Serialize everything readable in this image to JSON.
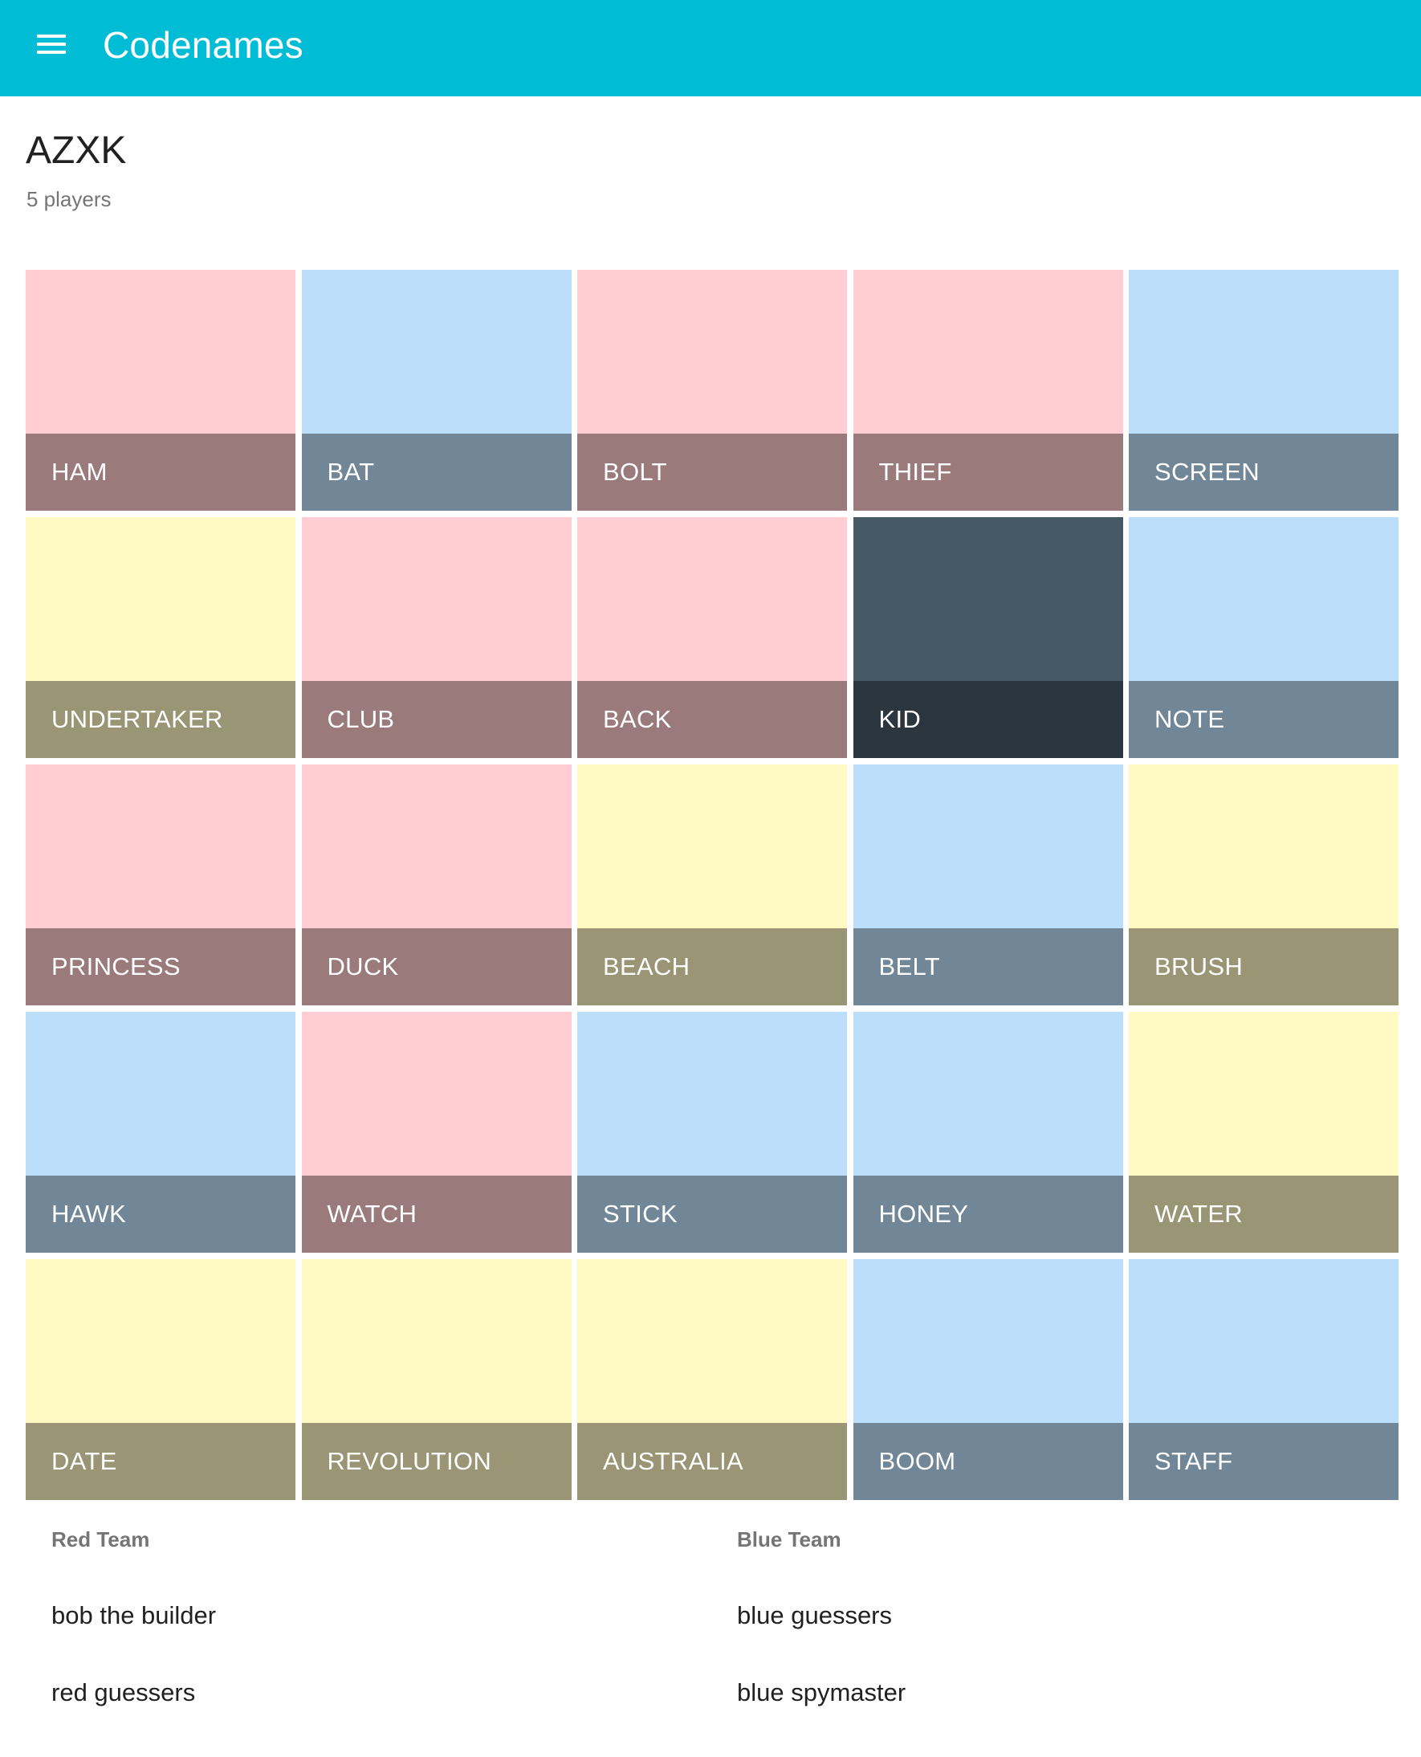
{
  "appbar": {
    "title": "Codenames",
    "menu_icon": "hamburger-menu-icon",
    "color": "#00BCD4"
  },
  "game": {
    "code": "AZXK",
    "players": "5 players"
  },
  "colors": {
    "red": {
      "tile": "#FFCDD2",
      "band": "#9A7A7B"
    },
    "blue": {
      "tile": "#BBDEFB",
      "band": "#718797"
    },
    "neutral": {
      "tile": "#FFF9C4",
      "band": "#999575"
    },
    "assassin": {
      "tile": "#455A64",
      "band": "#2C363E"
    }
  },
  "board": [
    {
      "word": "HAM",
      "team": "red"
    },
    {
      "word": "BAT",
      "team": "blue"
    },
    {
      "word": "BOLT",
      "team": "red"
    },
    {
      "word": "THIEF",
      "team": "red"
    },
    {
      "word": "SCREEN",
      "team": "blue"
    },
    {
      "word": "UNDERTAKER",
      "team": "neutral"
    },
    {
      "word": "CLUB",
      "team": "red"
    },
    {
      "word": "BACK",
      "team": "red"
    },
    {
      "word": "KID",
      "team": "assassin"
    },
    {
      "word": "NOTE",
      "team": "blue"
    },
    {
      "word": "PRINCESS",
      "team": "red"
    },
    {
      "word": "DUCK",
      "team": "red"
    },
    {
      "word": "BEACH",
      "team": "neutral"
    },
    {
      "word": "BELT",
      "team": "blue"
    },
    {
      "word": "BRUSH",
      "team": "neutral"
    },
    {
      "word": "HAWK",
      "team": "blue"
    },
    {
      "word": "WATCH",
      "team": "red"
    },
    {
      "word": "STICK",
      "team": "blue"
    },
    {
      "word": "HONEY",
      "team": "blue"
    },
    {
      "word": "WATER",
      "team": "neutral"
    },
    {
      "word": "DATE",
      "team": "neutral"
    },
    {
      "word": "REVOLUTION",
      "team": "neutral"
    },
    {
      "word": "AUSTRALIA",
      "team": "neutral"
    },
    {
      "word": "BOOM",
      "team": "blue"
    },
    {
      "word": "STAFF",
      "team": "blue"
    }
  ],
  "teams": {
    "red": {
      "label": "Red Team",
      "members": [
        "bob the builder",
        "red guessers"
      ]
    },
    "blue": {
      "label": "Blue Team",
      "members": [
        "blue guessers",
        "blue spymaster"
      ]
    }
  }
}
